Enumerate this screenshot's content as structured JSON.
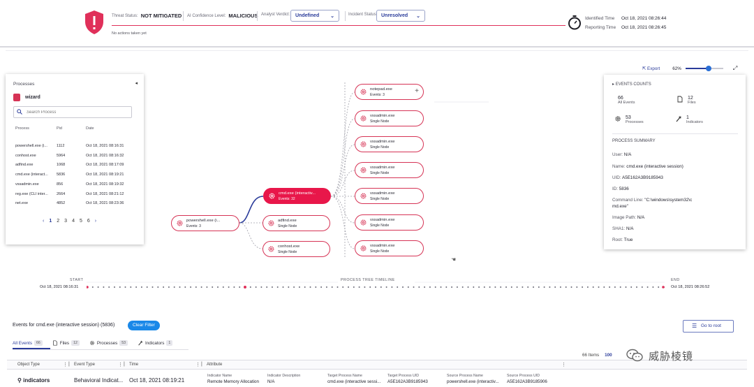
{
  "header": {
    "threat_status_label": "Threat Status:",
    "threat_status_value": "NOT MITIGATED",
    "ai_label": "AI Confidence Level:",
    "ai_value": "MALICIOUS",
    "verdict_label": "Analyst Verdict:",
    "verdict_value": "Undefined",
    "incident_label": "Incident Status:",
    "incident_value": "Unresolved",
    "no_actions": "No actions taken yet",
    "identified_label": "Identified Time",
    "identified_value": "Oct 18, 2021 08:26:44",
    "reporting_label": "Reporting Time",
    "reporting_value": "Oct 18, 2021 08:26:45",
    "accent_color": "#e0305a"
  },
  "processes_panel": {
    "title": "Processes",
    "host": "wizard",
    "search_placeholder": "Search Process",
    "columns": [
      "Process",
      "Pid",
      "Date"
    ],
    "rows": [
      {
        "name": "powershell.exe (i...",
        "pid": "1112",
        "date": "Oct 18, 2021 08:16:31"
      },
      {
        "name": "conhost.exe",
        "pid": "5964",
        "date": "Oct 18, 2021 08:16:32"
      },
      {
        "name": "adfind.exe",
        "pid": "1068",
        "date": "Oct 18, 2021 08:17:09"
      },
      {
        "name": "cmd.exe (interact...",
        "pid": "5836",
        "date": "Oct 18, 2021 08:19:21"
      },
      {
        "name": "vssadmin.exe",
        "pid": "856",
        "date": "Oct 18, 2021 08:19:32"
      },
      {
        "name": "reg.exe (CLI inter...",
        "pid": "2664",
        "date": "Oct 18, 2021 08:21:12"
      },
      {
        "name": "net.exe",
        "pid": "4852",
        "date": "Oct 18, 2021 08:23:36"
      }
    ],
    "pages": [
      "1",
      "2",
      "3",
      "4",
      "5",
      "6"
    ]
  },
  "tree": {
    "root": {
      "title": "powershell.exe (i...",
      "sub": "Events: 3"
    },
    "selected": {
      "title": "cmd.exe (interactiv...",
      "sub": "Events: 32"
    },
    "siblings": [
      {
        "title": "adfind.exe",
        "sub": "Single Node"
      },
      {
        "title": "conhost.exe",
        "sub": "Single Node"
      }
    ],
    "children": [
      {
        "title": "notepad.exe",
        "sub": "Events: 3"
      },
      {
        "title": "vssadmin.exe",
        "sub": "Single Node"
      },
      {
        "title": "vssadmin.exe",
        "sub": "Single Node"
      },
      {
        "title": "vssadmin.exe",
        "sub": "Single Node"
      },
      {
        "title": "vssadmin.exe",
        "sub": "Single Node"
      },
      {
        "title": "vssadmin.exe",
        "sub": "Single Node"
      },
      {
        "title": "vssadmin.exe",
        "sub": "Single Node"
      }
    ]
  },
  "toolbar": {
    "export_label": "Export",
    "zoom_value": "62%",
    "zoom_fraction": 0.62
  },
  "events_panel": {
    "title": "EVENTS COUNTS",
    "stats": [
      {
        "num": "66",
        "cap": "All Events"
      },
      {
        "num": "12",
        "cap": "Files"
      },
      {
        "num": "53",
        "cap": "Processes"
      },
      {
        "num": "1",
        "cap": "Indicators"
      }
    ],
    "summary_title": "PROCESS SUMMARY",
    "summary": [
      {
        "k": "User:",
        "v": "N/A"
      },
      {
        "k": "Name:",
        "v": "cmd.exe (interactive session)"
      },
      {
        "k": "UID:",
        "v": "A5E162A3B9185943"
      },
      {
        "k": "ID:",
        "v": "5836"
      },
      {
        "k": "Command Line:",
        "v": "\"C:\\windows\\system32\\c"
      },
      {
        "k": "",
        "v": "md.exe\""
      },
      {
        "k": "Image Path:",
        "v": "N/A"
      },
      {
        "k": "SHA1:",
        "v": "N/A"
      },
      {
        "k": "Root:",
        "v": "True"
      }
    ]
  },
  "timeline": {
    "start_label": "START",
    "end_label": "END",
    "title": "PROCESS TREE TIMELINE",
    "start_date": "Oct 18, 2021 08:16:31",
    "end_date": "Oct 18, 2021 08:26:52"
  },
  "events": {
    "heading": "Events for cmd.exe (interactive session) (5836)",
    "clear_filter": "Clear Filter",
    "goto_root": "Go to root",
    "tabs": [
      {
        "label": "All Events",
        "count": "66"
      },
      {
        "label": "Files",
        "count": "12"
      },
      {
        "label": "Processes",
        "count": "53"
      },
      {
        "label": "Indicators",
        "count": "1"
      }
    ],
    "items_count": "66 Items",
    "items_per_page": "100",
    "columns": [
      "Object Type",
      "Event Type",
      "Time",
      "Attribute"
    ],
    "row": {
      "object_type": "indicators",
      "event_type": "Behavioral Indicat...",
      "time": "Oct 18, 2021 08:19:21",
      "attrs": [
        {
          "k": "Indicator Name",
          "v": "Remote Memory Allocation"
        },
        {
          "k": "Indicator Description",
          "v": "N/A"
        },
        {
          "k": "Target Process Name",
          "v": "cmd.exe (interactive sessi..."
        },
        {
          "k": "Target Process UID",
          "v": "A5E162A3B9185943"
        },
        {
          "k": "Source Process Name",
          "v": "powershell.exe (interactiv..."
        },
        {
          "k": "Source Process UID",
          "v": "A5E162A3B9185906"
        }
      ]
    }
  },
  "watermark": {
    "text": "威胁棱镜"
  }
}
